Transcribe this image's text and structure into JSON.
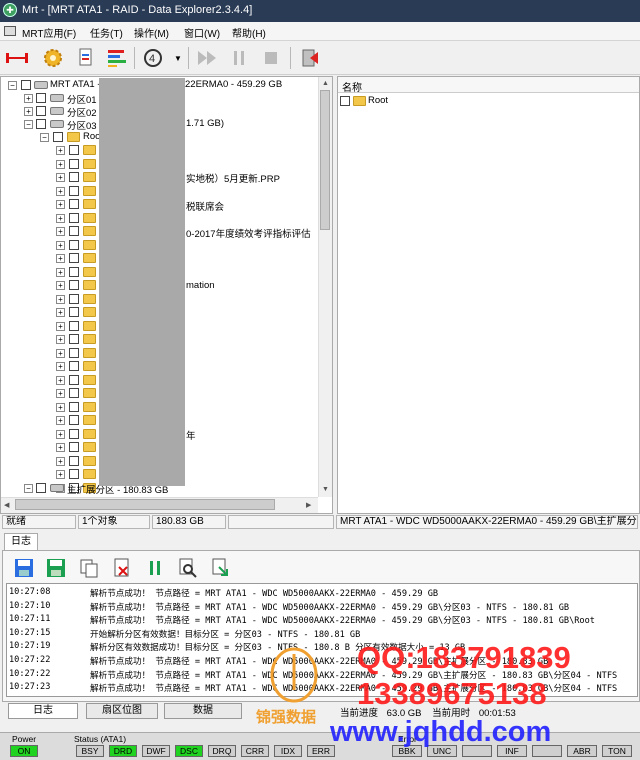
{
  "window": {
    "title": "Mrt - [MRT ATA1 - RAID - Data Explorer2.3.4.4]"
  },
  "menu": {
    "items": [
      "MRT应用(F)",
      "任务(T)",
      "操作(M)",
      "窗口(W)",
      "帮助(H)"
    ]
  },
  "tree": {
    "root_label": "MRT ATA1 - ",
    "root_suffix": "22ERMA0 - 459.29 GB",
    "p01": "分区01",
    "p02": "分区02",
    "p03": "分区03",
    "p03_size": "1.71 GB)",
    "root_folder": "Root",
    "visible_names": [
      "实地税）5月更新.PRP",
      "税联席会",
      "0-2017年度绩效考评指标评估",
      "mation",
      "年"
    ],
    "ext_partition": "主扩展分区 - 180.83 GB"
  },
  "right_pane": {
    "column_header": "名称",
    "items": [
      "Root"
    ]
  },
  "statusbar": {
    "ready": "就绪",
    "objects": "1个对象",
    "size": "180.83 GB",
    "disk_info": "MRT ATA1 - WDC WD5000AAKX-22ERMA0 - 459.29 GB\\主扩展分区"
  },
  "log": {
    "tab_label": "日志",
    "lines": [
      {
        "time": "10:27:08",
        "msg": "解析节点成功！ 节点路径 = MRT ATA1 - WDC WD5000AAKX-22ERMA0 - 459.29 GB"
      },
      {
        "time": "10:27:10",
        "msg": "解析节点成功！ 节点路径 = MRT ATA1 - WDC WD5000AAKX-22ERMA0 - 459.29 GB\\分区03 - NTFS - 180.81 GB"
      },
      {
        "time": "10:27:11",
        "msg": "解析节点成功！ 节点路径 = MRT ATA1 - WDC WD5000AAKX-22ERMA0 - 459.29 GB\\分区03 - NTFS - 180.81 GB\\Root"
      },
      {
        "time": "10:27:15",
        "msg": "开始解析分区有效数据！目标分区 = 分区03 - NTFS - 180.81 GB"
      },
      {
        "time": "10:27:19",
        "msg": "解析分区有效数据成功！目标分区 = 分区03 - NTFS - 180.8  B  分区有效数据大小 = 13 GB"
      },
      {
        "time": "10:27:22",
        "msg": "解析节点成功！ 节点路径 = MRT ATA1 - WDC WD5000AAKX-22ERMA0 - 459.29 GB\\主扩展分区 - 180.83 GB"
      },
      {
        "time": "10:27:22",
        "msg": "解析节点成功！ 节点路径 = MRT ATA1 - WDC WD5000AAKX-22ERMA0 - 459.29 GB\\主扩展分区 - 180.83 GB\\分区04 - NTFS"
      },
      {
        "time": "10:27:23",
        "msg": "解析节点成功！ 节点路径 = MRT ATA1 - WDC WD5000AAKX-22ERMA0 - 459.29 GB\\主扩展分区 - 180.83 GB\\分区04 - NTFS"
      }
    ]
  },
  "bottom_tabs": [
    "日志",
    "扇区位图",
    "数据"
  ],
  "progress": {
    "label1": "当前进度",
    "value1": "63.0 GB",
    "label2": "当前用时",
    "value2": "00:01:53"
  },
  "status_leds": {
    "power_label": "Power",
    "power": "ON",
    "status_label": "Status (ATA1)",
    "status": [
      "BSY",
      "DRD",
      "DWF",
      "DSC",
      "DRQ",
      "CRR",
      "IDX",
      "ERR"
    ],
    "error_label": "Error",
    "errors": [
      "BBK",
      "UNC",
      "",
      "INF",
      "",
      "ABR",
      "TON"
    ]
  },
  "watermark": {
    "qq": "QQ:183791839",
    "phone": "13389675138",
    "brand": "锦强数据",
    "url": "www.jqhdd.com"
  },
  "colors": {
    "title_bar": "#2a3b55",
    "led_on": "#21d321",
    "watermark_red": "#ff1a1a",
    "watermark_blue": "#2020ff",
    "watermark_orange": "#f0a030"
  }
}
